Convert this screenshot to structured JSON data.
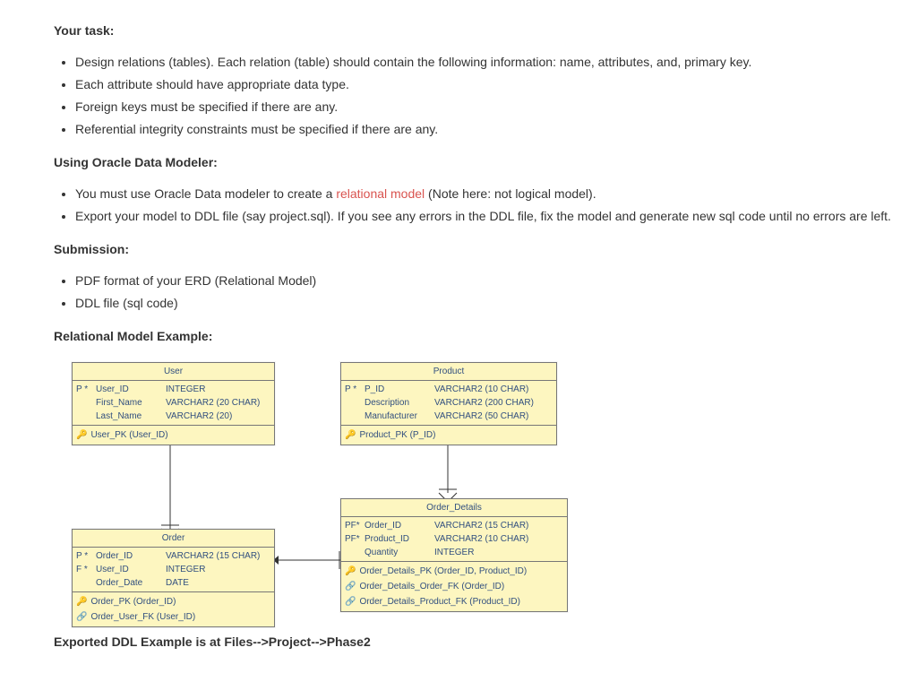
{
  "task_heading": "Your task:",
  "task_items": [
    "Design relations (tables). Each relation (table) should contain the following information: name, attributes, and, primary key.",
    "Each attribute should have appropriate data type.",
    "Foreign keys must be specified if there are any.",
    "Referential integrity constraints must be specified if there are any."
  ],
  "modeler_heading": "Using Oracle Data Modeler:",
  "modeler_items_pre_red": "You must use Oracle Data modeler to create a ",
  "modeler_items_red": "relational model",
  "modeler_items_post_red": " (Note here: not logical model).",
  "modeler_item2": "Export your model to DDL file (say project.sql). If you see any errors in the DDL file, fix the model and generate new sql code until no errors are left.",
  "submission_heading": "Submission:",
  "submission_items": [
    "PDF format of your ERD (Relational Model)",
    "DDL file (sql code)"
  ],
  "example_heading": "Relational Model Example:",
  "footer": "Exported DDL Example is at Files-->Project-->Phase2",
  "entities": {
    "user": {
      "title": "User",
      "attrs": [
        {
          "flags": "P  *",
          "name": "User_ID",
          "type": "INTEGER"
        },
        {
          "flags": "",
          "name": "First_Name",
          "type": "VARCHAR2 (20 CHAR)"
        },
        {
          "flags": "",
          "name": "Last_Name",
          "type": "VARCHAR2 (20)"
        }
      ],
      "keys": [
        {
          "kind": "pk",
          "text": "User_PK (User_ID)"
        }
      ]
    },
    "product": {
      "title": "Product",
      "attrs": [
        {
          "flags": "P  *",
          "name": "P_ID",
          "type": "VARCHAR2 (10 CHAR)"
        },
        {
          "flags": "",
          "name": "Description",
          "type": "VARCHAR2 (200 CHAR)"
        },
        {
          "flags": "",
          "name": "Manufacturer",
          "type": "VARCHAR2 (50 CHAR)"
        }
      ],
      "keys": [
        {
          "kind": "pk",
          "text": "Product_PK (P_ID)"
        }
      ]
    },
    "order": {
      "title": "Order",
      "attrs": [
        {
          "flags": "P  *",
          "name": "Order_ID",
          "type": "VARCHAR2 (15 CHAR)"
        },
        {
          "flags": "F  *",
          "name": "User_ID",
          "type": "INTEGER"
        },
        {
          "flags": "",
          "name": "Order_Date",
          "type": "DATE"
        }
      ],
      "keys": [
        {
          "kind": "pk",
          "text": "Order_PK (Order_ID)"
        },
        {
          "kind": "fk",
          "text": "Order_User_FK (User_ID)"
        }
      ]
    },
    "order_details": {
      "title": "Order_Details",
      "attrs": [
        {
          "flags": "PF*",
          "name": "Order_ID",
          "type": "VARCHAR2 (15 CHAR)"
        },
        {
          "flags": "PF*",
          "name": "Product_ID",
          "type": "VARCHAR2 (10 CHAR)"
        },
        {
          "flags": "",
          "name": "Quantity",
          "type": "INTEGER"
        }
      ],
      "keys": [
        {
          "kind": "pk",
          "text": "Order_Details_PK (Order_ID, Product_ID)"
        },
        {
          "kind": "fk",
          "text": "Order_Details_Order_FK (Order_ID)"
        },
        {
          "kind": "fk",
          "text": "Order_Details_Product_FK (Product_ID)"
        }
      ]
    }
  }
}
